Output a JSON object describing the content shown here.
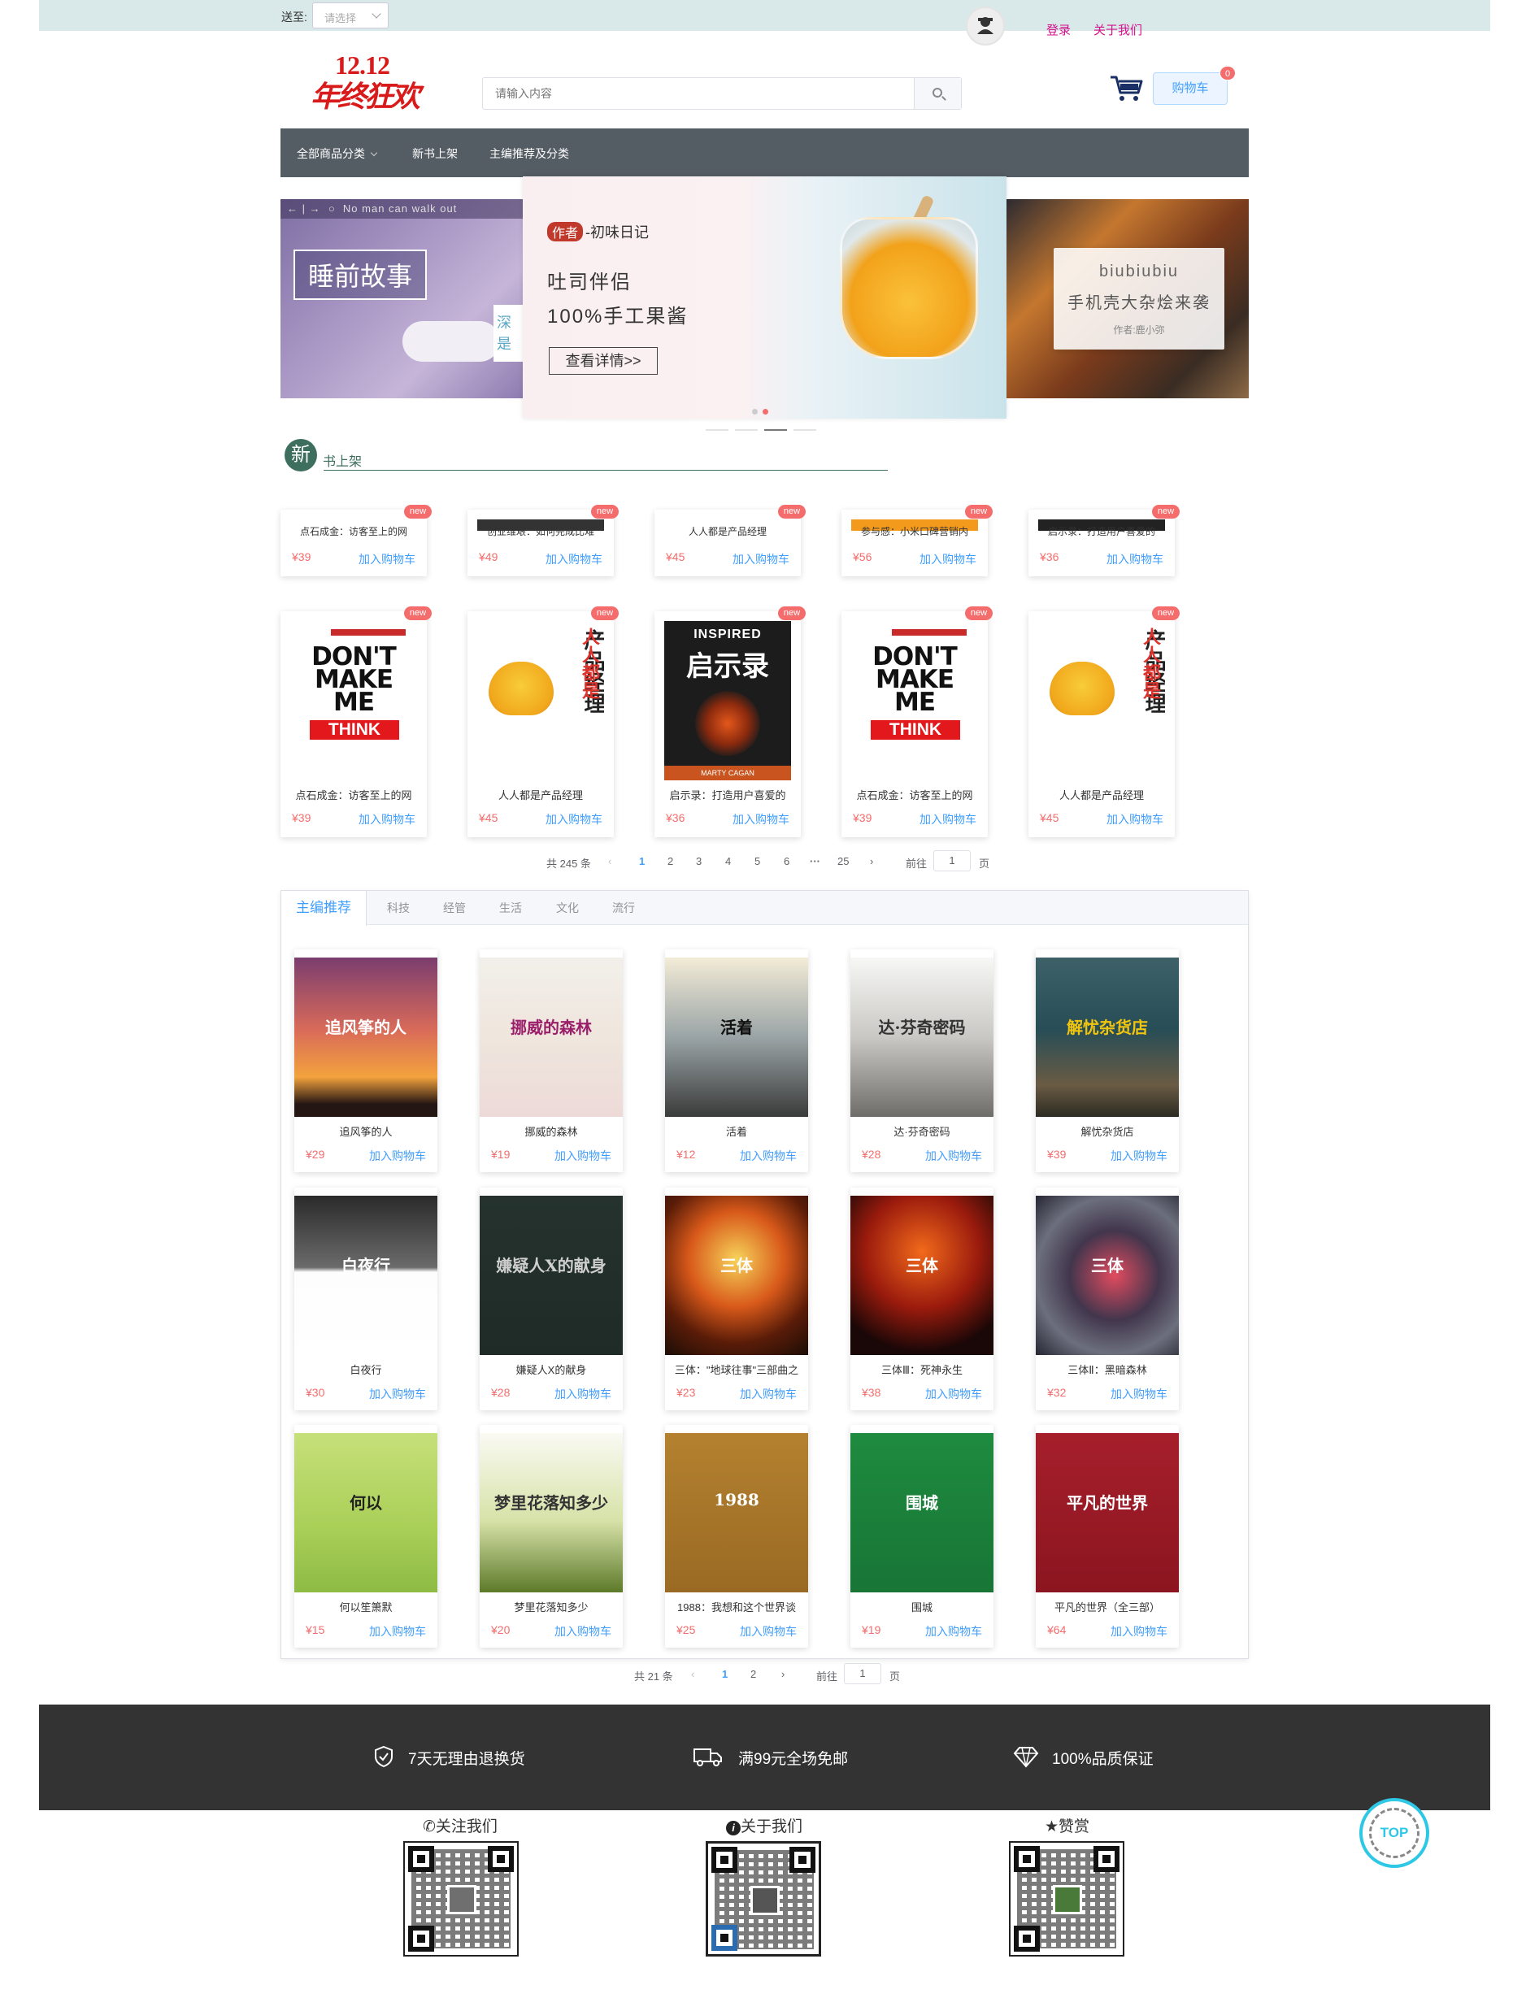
{
  "topbar": {
    "ship_to_label": "送至:",
    "ship_select_placeholder": "请选择",
    "login": "登录",
    "about": "关于我们"
  },
  "header": {
    "logo_line1": "12.12",
    "logo_line2": "年终狂欢",
    "search_placeholder": "请输入内容",
    "cart_label": "购物车",
    "cart_count": "0"
  },
  "nav": {
    "all_categories": "全部商品分类",
    "new_arrivals": "新书上架",
    "editor_picks": "主编推荐及分类"
  },
  "banner": {
    "left_strip": "No man can walk out",
    "left_title": "睡前故事",
    "left_side": "深是",
    "mid_tag": "作者",
    "mid_author": "-初味日记",
    "mid_line1": "吐司伴侣",
    "mid_line2": "100%手工果酱",
    "mid_button": "查看详情>>",
    "right_title": "biubiubiu",
    "right_subtitle": "手机壳大杂烩来袭",
    "right_author": "作者:鹿小弥"
  },
  "new_section": {
    "badge": "新",
    "title": "书上架",
    "badge_text": "new",
    "compact_items": [
      {
        "name": "点石成金：访客至上的网",
        "price": "¥39",
        "add": "加入购物车"
      },
      {
        "name": "创业维艰：如何完成比难",
        "price": "¥49",
        "add": "加入购物车"
      },
      {
        "name": "人人都是产品经理",
        "price": "¥45",
        "add": "加入购物车"
      },
      {
        "name": "参与感：小米口碑营销内",
        "price": "¥56",
        "add": "加入购物车"
      },
      {
        "name": "启示录：打造用户喜爱的",
        "price": "¥36",
        "add": "加入购物车"
      }
    ],
    "items": [
      {
        "name": "点石成金：访客至上的网",
        "price": "¥39",
        "add": "加入购物车"
      },
      {
        "name": "人人都是产品经理",
        "price": "¥45",
        "add": "加入购物车"
      },
      {
        "name": "启示录：打造用户喜爱的",
        "price": "¥36",
        "add": "加入购物车"
      },
      {
        "name": "点石成金：访客至上的网",
        "price": "¥39",
        "add": "加入购物车"
      },
      {
        "name": "人人都是产品经理",
        "price": "¥45",
        "add": "加入购物车"
      }
    ],
    "cover_texts": {
      "dmm_title": "DON'T MAKE ME",
      "dmm_think": "THINK",
      "pm_title": "产品经理",
      "pm_accent": "人人都是",
      "ins_top": "INSPIRED",
      "ins_title": "启示录",
      "ins_author": "MARTY CAGAN"
    }
  },
  "pager1": {
    "total": "共 245 条",
    "pages": [
      "1",
      "2",
      "3",
      "4",
      "5",
      "6",
      "···",
      "25"
    ],
    "goto": "前往",
    "goto_value": "1",
    "page_unit": "页"
  },
  "rec_section": {
    "tabs": [
      "主编推荐",
      "科技",
      "经管",
      "生活",
      "文化",
      "流行"
    ],
    "rows": [
      [
        {
          "name": "追风筝的人",
          "price": "¥29",
          "add": "加入购物车",
          "cover_text": "追风筝的人"
        },
        {
          "name": "挪威的森林",
          "price": "¥19",
          "add": "加入购物车",
          "cover_text": "挪威的森林"
        },
        {
          "name": "活着",
          "price": "¥12",
          "add": "加入购物车",
          "cover_text": "活着"
        },
        {
          "name": "达·芬奇密码",
          "price": "¥28",
          "add": "加入购物车",
          "cover_text": "达·芬奇密码"
        },
        {
          "name": "解忧杂货店",
          "price": "¥39",
          "add": "加入购物车",
          "cover_text": "解忧杂货店"
        }
      ],
      [
        {
          "name": "白夜行",
          "price": "¥30",
          "add": "加入购物车",
          "cover_text": "白夜行"
        },
        {
          "name": "嫌疑人X的献身",
          "price": "¥28",
          "add": "加入购物车",
          "cover_text": "嫌疑人X的献身"
        },
        {
          "name": "三体：\"地球往事\"三部曲之",
          "price": "¥23",
          "add": "加入购物车",
          "cover_text": "三体"
        },
        {
          "name": "三体Ⅲ：死神永生",
          "price": "¥38",
          "add": "加入购物车",
          "cover_text": "三体"
        },
        {
          "name": "三体Ⅱ：黑暗森林",
          "price": "¥32",
          "add": "加入购物车",
          "cover_text": "三体"
        }
      ],
      [
        {
          "name": "何以笙箫默",
          "price": "¥15",
          "add": "加入购物车",
          "cover_text": "何以"
        },
        {
          "name": "梦里花落知多少",
          "price": "¥20",
          "add": "加入购物车",
          "cover_text": "梦里花落知多少"
        },
        {
          "name": "1988：我想和这个世界谈",
          "price": "¥25",
          "add": "加入购物车",
          "cover_text": "1988"
        },
        {
          "name": "围城",
          "price": "¥19",
          "add": "加入购物车",
          "cover_text": "围城"
        },
        {
          "name": "平凡的世界（全三部）",
          "price": "¥64",
          "add": "加入购物车",
          "cover_text": "平凡的世界"
        }
      ]
    ]
  },
  "pager2": {
    "total": "共 21 条",
    "pages": [
      "1",
      "2"
    ],
    "goto": "前往",
    "goto_value": "1",
    "page_unit": "页"
  },
  "footer": {
    "promise1": "7天无理由退换货",
    "promise2": "满99元全场免邮",
    "promise3": "100%品质保证",
    "qr1_title": "关注我们",
    "qr2_title": "关于我们",
    "qr3_title": "赞赏",
    "top_button": "TOP"
  },
  "colors": {
    "price": "#f56c6c",
    "link": "#409eff",
    "nav_bg": "#545c64",
    "footer_bg": "#333333",
    "accent_green": "#3d6e5e",
    "top_link": "#d6118d"
  }
}
